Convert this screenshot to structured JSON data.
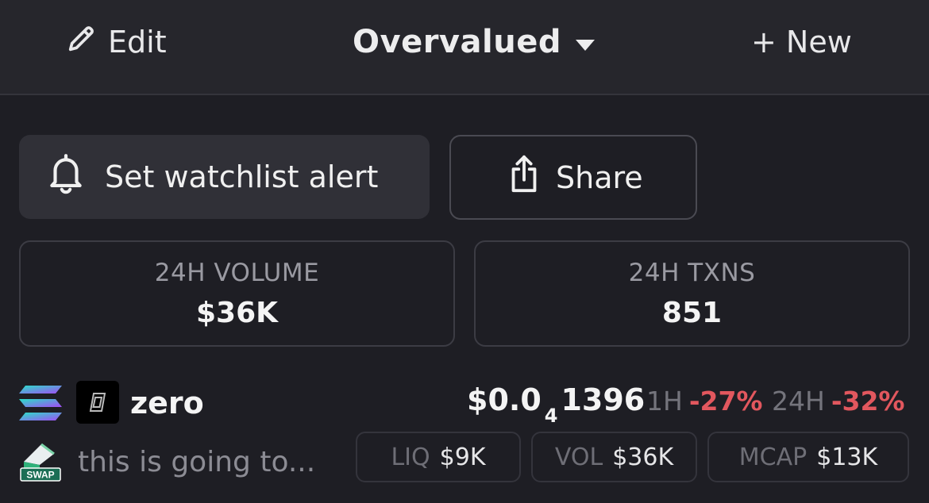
{
  "topbar": {
    "edit_label": "Edit",
    "watchlist_name": "Overvalued",
    "new_label": "+ New"
  },
  "actions": {
    "alert_label": "Set watchlist alert",
    "share_label": "Share"
  },
  "stats": [
    {
      "label": "24H VOLUME",
      "value": "$36K"
    },
    {
      "label": "24H TXNS",
      "value": "851"
    }
  ],
  "token": {
    "name": "zero",
    "description": "this is going to...",
    "price_prefix": "$0.0",
    "price_zeros": "4",
    "price_digits": "1396",
    "change_1h_label": "1H",
    "change_1h_value": "-27%",
    "change_24h_label": "24H",
    "change_24h_value": "-32%",
    "dex_badge": "SWAP",
    "liq_label": "LIQ",
    "liq_value": "$9K",
    "vol_label": "VOL",
    "vol_value": "$36K",
    "mcap_label": "MCAP",
    "mcap_value": "$13K"
  },
  "icons": {
    "edit": "pencil-icon",
    "dropdown": "caret-down-icon",
    "alert": "bell-icon",
    "share": "share-icon",
    "chain": "solana-icon",
    "dex": "raydium-swap-icon"
  },
  "colors": {
    "negative": "#e2575e",
    "background": "#1e1e24",
    "header": "#26262c"
  }
}
